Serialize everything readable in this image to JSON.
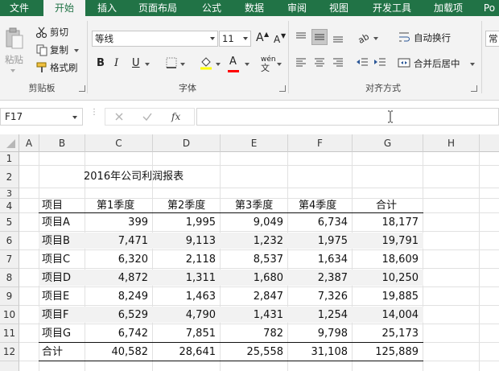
{
  "ribbon_tabs": [
    "文件",
    "开始",
    "插入",
    "页面布局",
    "公式",
    "数据",
    "审阅",
    "视图",
    "开发工具",
    "加载项",
    "Po"
  ],
  "active_tab": "开始",
  "clipboard": {
    "paste_label": "粘贴",
    "cut_label": "剪切",
    "copy_label": "复制",
    "format_painter_label": "格式刷",
    "group_label": "剪贴板"
  },
  "font": {
    "font_name": "等线",
    "font_size": "11",
    "grow_label": "A",
    "shrink_label": "A",
    "bold_label": "B",
    "italic_label": "I",
    "underline_label": "U",
    "font_color_label": "A",
    "phonetic_label": "wén",
    "font_color": "#ff0000",
    "group_label": "字体"
  },
  "alignment": {
    "wrap_text_label": "自动换行",
    "merge_center_label": "合并后居中",
    "group_label": "对齐方式"
  },
  "number": {
    "format_partial": "常"
  },
  "formula_bar": {
    "name_box": "F17",
    "fx_label": "fx",
    "formula": ""
  },
  "sheet": {
    "columns": [
      "A",
      "B",
      "C",
      "D",
      "E",
      "F",
      "G",
      "H"
    ],
    "rows": [
      "1",
      "2",
      "3",
      "4",
      "5",
      "6",
      "7",
      "8",
      "9",
      "10",
      "11",
      "12"
    ],
    "title": "2016年公司利润报表",
    "headers": [
      "项目",
      "第1季度",
      "第2季度",
      "第3季度",
      "第4季度",
      "合计"
    ],
    "data": [
      [
        "项目A",
        "399",
        "1,995",
        "9,049",
        "6,734",
        "18,177"
      ],
      [
        "项目B",
        "7,471",
        "9,113",
        "1,232",
        "1,975",
        "19,791"
      ],
      [
        "项目C",
        "6,320",
        "2,118",
        "8,537",
        "1,634",
        "18,609"
      ],
      [
        "项目D",
        "4,872",
        "1,311",
        "1,680",
        "2,387",
        "10,250"
      ],
      [
        "项目E",
        "8,249",
        "1,463",
        "2,847",
        "7,326",
        "19,885"
      ],
      [
        "项目F",
        "6,529",
        "4,790",
        "1,431",
        "1,254",
        "14,004"
      ],
      [
        "项目G",
        "6,742",
        "7,851",
        "782",
        "9,798",
        "25,173"
      ]
    ],
    "total": [
      "合计",
      "40,582",
      "28,641",
      "25,558",
      "31,108",
      "125,889"
    ]
  },
  "colors": {
    "ribbon_green": "#217346",
    "band_gray": "#f2f2f2"
  }
}
